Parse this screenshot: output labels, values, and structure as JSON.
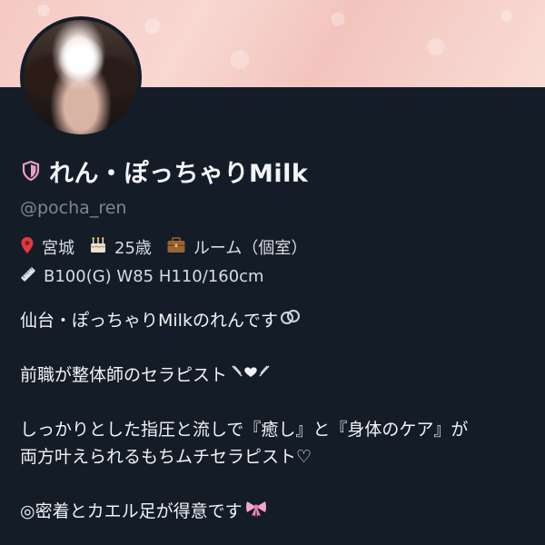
{
  "profile": {
    "display_name": "れん・ぽっちゃりMilk",
    "handle": "@pocha_ren",
    "meta": {
      "location": "宮城",
      "age": "25歳",
      "room": "ルーム（個室）",
      "measurements": "B100(G) W85 H110/160cm"
    },
    "icons": {
      "verified": "shield-icon",
      "location": "pin-icon",
      "birthday": "cake-icon",
      "job": "briefcase-icon",
      "measurements": "ruler-icon"
    },
    "bio_lines": [
      "仙台・ぽっちゃりMilkのれんです",
      "",
      "前職が整体師のセラピスト",
      "",
      "しっかりとした指圧と流しで『癒し』と『身体のケア』が",
      "両方叶えられるもちムチセラピスト♡",
      "",
      "◎密着とカエル足が得意です"
    ]
  },
  "colors": {
    "background": "#141c28",
    "accent_pink": "#e79fc3",
    "handle_gray": "#7b8795"
  }
}
